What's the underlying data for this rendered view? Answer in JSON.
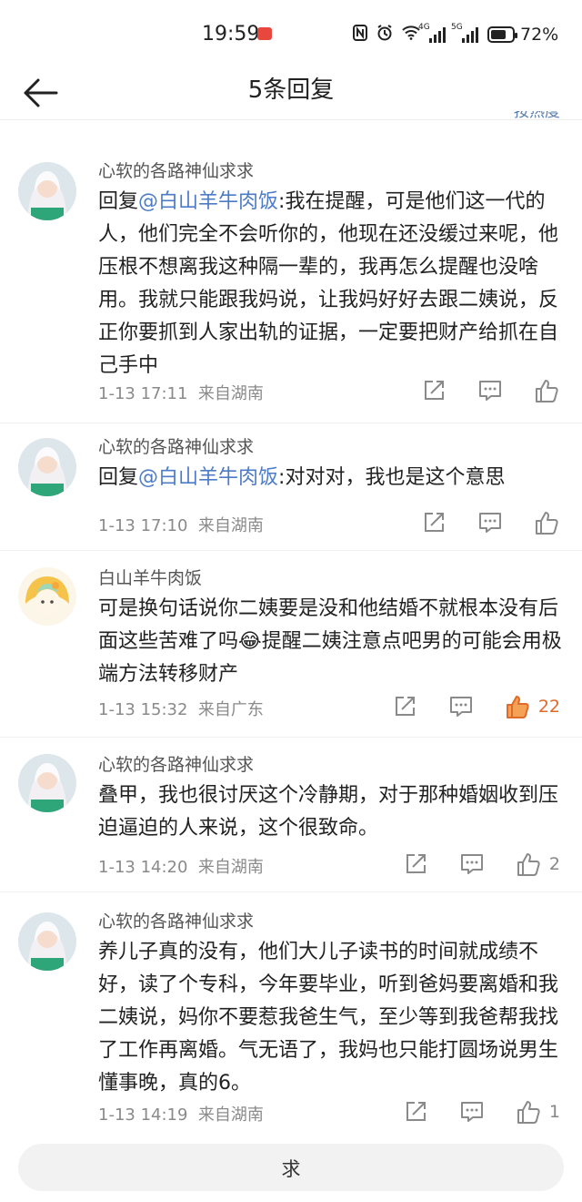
{
  "status_bar": {
    "time": "19:59",
    "battery": "72%",
    "battery_level": 0.72,
    "signal1_label": "4G",
    "signal2_label": "5G"
  },
  "header": {
    "title": "5条回复",
    "sort_label": "按热度"
  },
  "comments": [
    {
      "user": "心软的各路神仙求求",
      "reply_prefix": "回复",
      "mention": "@白山羊牛肉饭",
      "text": ":我在提醒，可是他们这一代的人，他们完全不会听你的，他现在还没缓过来呢，他压根不想离我这种隔一辈的，我再怎么提醒也没啥用。我就只能跟我妈说，让我妈好好去跟二姨说，反正你要抓到人家出轨的证据，一定要把财产给抓在自己手中",
      "time": "1-13 17:11",
      "location": "来自湖南",
      "likes": ""
    },
    {
      "user": "心软的各路神仙求求",
      "reply_prefix": "回复",
      "mention": "@白山羊牛肉饭",
      "text": ":对对对，我也是这个意思",
      "time": "1-13 17:10",
      "location": "来自湖南",
      "likes": ""
    },
    {
      "user": "白山羊牛肉饭",
      "text_a": "可是换句话说你二姨要是没和他结婚不就根本没有后面这些苦难了吗",
      "emoji": "😂",
      "text_b": "提醒二姨注意点吧男的可能会用极端方法转移财产",
      "time": "1-13 15:32",
      "location": "来自广东",
      "likes": "22"
    },
    {
      "user": "心软的各路神仙求求",
      "text": "叠甲，我也很讨厌这个冷静期，对于那种婚姻收到压迫逼迫的人来说，这个很致命。",
      "time": "1-13 14:20",
      "location": "来自湖南",
      "likes": "2"
    },
    {
      "user": "心软的各路神仙求求",
      "text": "养儿子真的没有，他们大儿子读书的时间就成绩不好，读了个专科，今年要毕业，听到爸妈要离婚和我二姨说，妈你不要惹我爸生气，至少等到我爸帮我找了工作再离婚。气无语了，我妈也只能打圆场说男生懂事晚，真的6。",
      "time": "1-13 14:19",
      "location": "来自湖南",
      "likes": "1"
    }
  ],
  "reply_bar": {
    "placeholder": "求"
  },
  "colors": {
    "mention": "#4d7cc7",
    "hot_like": "#e06a2a",
    "meta": "#8a8a8a"
  }
}
